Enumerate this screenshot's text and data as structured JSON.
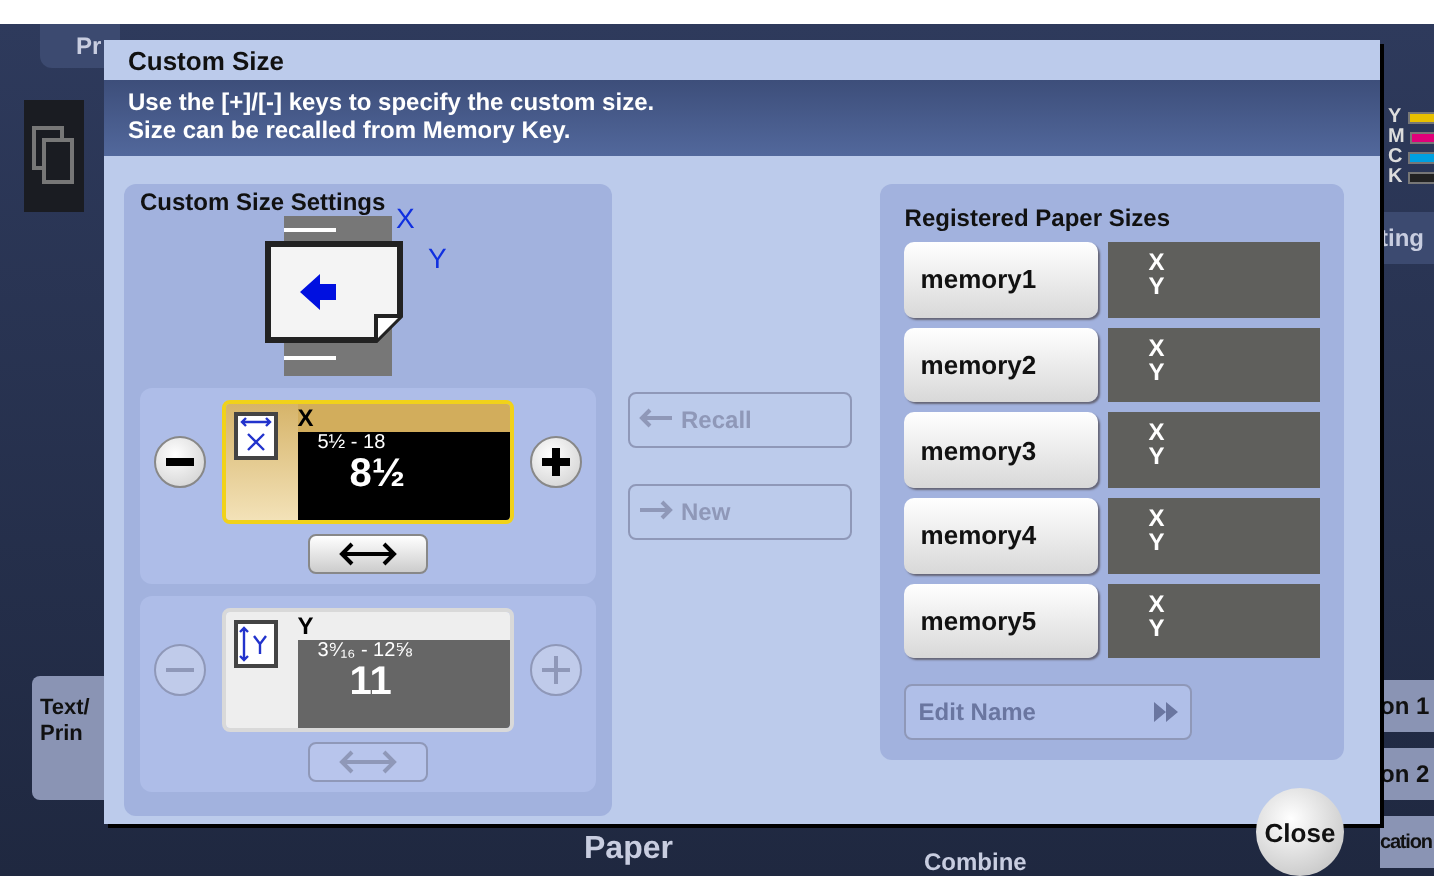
{
  "background": {
    "top_tab": "Pr",
    "side_buttons": [
      "ting",
      "on 1",
      "on 2",
      "cation"
    ],
    "toner_labels": [
      "Y",
      "M",
      "C",
      "K"
    ],
    "left_button": [
      "Text/",
      "Prin"
    ],
    "bottom_labels": [
      "Paper",
      "Combine"
    ]
  },
  "dialog": {
    "title": "Custom Size",
    "instructions": [
      "Use the [+]/[-] keys to specify the custom size.",
      "Size can be recalled from Memory Key."
    ],
    "settings": {
      "title": "Custom Size Settings",
      "diagram_labels": [
        "X",
        "Y"
      ],
      "axes": [
        {
          "kind": "x",
          "label": "X",
          "range": "5½ - 18",
          "value": "8½",
          "selected": true
        },
        {
          "kind": "y",
          "label": "Y",
          "range": "3⁹⁄₁₆ - 12⅝",
          "value": "11",
          "selected": false
        }
      ]
    },
    "actions": [
      {
        "label": "Recall",
        "disabled": true
      },
      {
        "label": "New",
        "disabled": true
      }
    ],
    "registered": {
      "title": "Registered Paper Sizes",
      "memories": [
        {
          "name": "memory1",
          "x": "X",
          "y": "Y"
        },
        {
          "name": "memory2",
          "x": "X",
          "y": "Y"
        },
        {
          "name": "memory3",
          "x": "X",
          "y": "Y"
        },
        {
          "name": "memory4",
          "x": "X",
          "y": "Y"
        },
        {
          "name": "memory5",
          "x": "X",
          "y": "Y"
        }
      ],
      "edit_name": {
        "label": "Edit Name",
        "disabled": true
      }
    },
    "close": "Close"
  }
}
